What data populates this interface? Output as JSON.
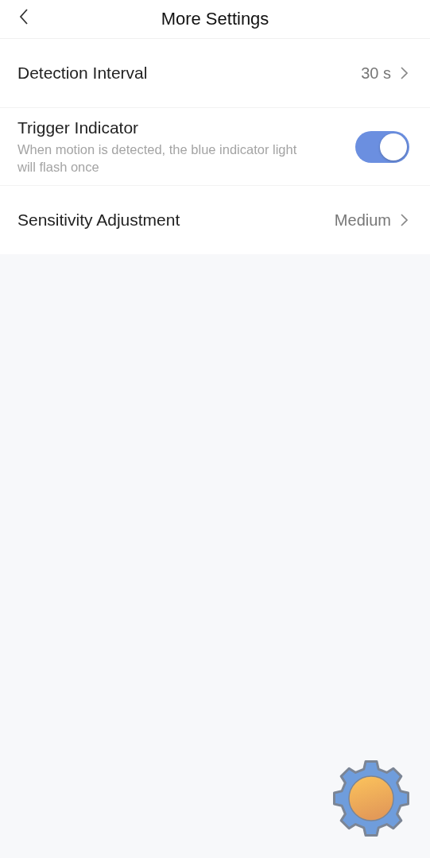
{
  "header": {
    "title": "More Settings"
  },
  "rows": [
    {
      "kind": "value",
      "label": "Detection Interval",
      "value": "30 s"
    },
    {
      "kind": "toggle",
      "label": "Trigger Indicator",
      "description": "When motion is detected, the blue indicator light will flash once",
      "on": true
    },
    {
      "kind": "value",
      "label": "Sensitivity Adjustment",
      "value": "Medium"
    }
  ]
}
